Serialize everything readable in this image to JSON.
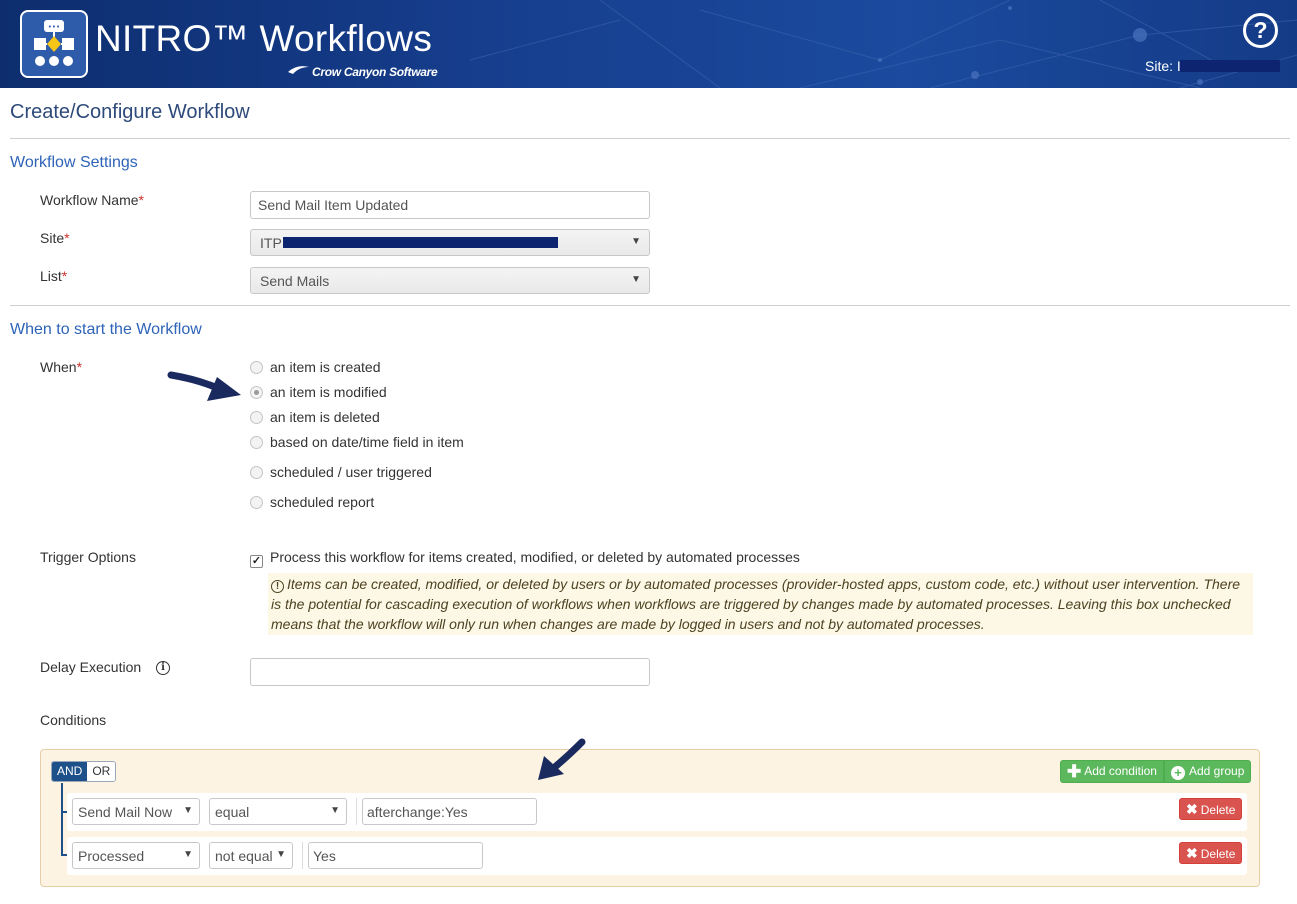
{
  "header": {
    "app_title": "NITRO™ Workflows",
    "brand": "Crow Canyon Software",
    "help_glyph": "?",
    "site_label": "Site: I"
  },
  "page": {
    "title": "Create/Configure Workflow"
  },
  "settings": {
    "section_title": "Workflow Settings",
    "name_label": "Workflow Name",
    "name_value": "Send Mail Item Updated",
    "site_label": "Site",
    "site_value": "ITP",
    "list_label": "List",
    "list_value": "Send Mails",
    "required_mark": "*"
  },
  "start": {
    "section_title": "When to start the Workflow",
    "when_label": "When",
    "options": [
      {
        "label": "an item is created",
        "checked": false
      },
      {
        "label": "an item is modified",
        "checked": true
      },
      {
        "label": "an item is deleted",
        "checked": false
      },
      {
        "label": "based on date/time field in item",
        "checked": false
      },
      {
        "label": "scheduled / user triggered",
        "checked": false
      },
      {
        "label": "scheduled report",
        "checked": false
      }
    ],
    "trigger_label": "Trigger Options",
    "trigger_checkbox_label": "Process this workflow for items created, modified, or deleted by automated processes",
    "trigger_checked": true,
    "trigger_warning": "Items can be created, modified, or deleted by users or by automated processes (provider-hosted apps, custom code, etc.) without user intervention. There is the potential for cascading execution of workflows when workflows are triggered by changes made by automated processes. Leaving this box unchecked means that the workflow will only run when changes are made by logged in users and not by automated processes.",
    "delay_label": "Delay Execution",
    "delay_value": "",
    "conditions_label": "Conditions"
  },
  "conditions": {
    "and_label": "AND",
    "or_label": "OR",
    "add_condition": "Add condition",
    "add_group": "Add group",
    "delete_label": "Delete",
    "rows": [
      {
        "field": "Send Mail Now",
        "operator": "equal",
        "value": "afterchange:Yes"
      },
      {
        "field": "Processed",
        "operator": "not equal",
        "value": "Yes"
      }
    ]
  },
  "colors": {
    "header_bg": "#173f8f",
    "section_title": "#2e63b8",
    "required": "#c9302c",
    "add_button": "#5cb85c",
    "delete_button": "#d9534f",
    "conditions_bg": "#fcf3e3",
    "annotation_arrow": "#1a2a5e"
  },
  "icons": [
    "workflow-logo-icon",
    "help-icon",
    "info-icon",
    "warning-icon",
    "plus-icon",
    "plus-circle-icon",
    "x-icon",
    "caret-down-icon",
    "arrow-annotation-icon"
  ]
}
